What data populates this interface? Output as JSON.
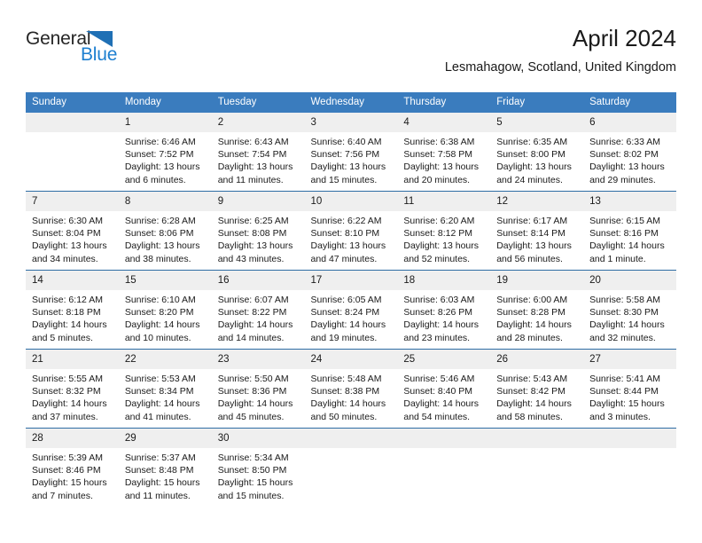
{
  "brand": {
    "name_part1": "General",
    "name_part2": "Blue",
    "triangle_color": "#1f70b5",
    "blue_color": "#1d7fd0"
  },
  "header": {
    "title": "April 2024",
    "subtitle": "Lesmahagow, Scotland, United Kingdom"
  },
  "theme": {
    "header_bg": "#3a7cbe",
    "row_divider": "#2e6da4",
    "daynum_bg": "#efefef"
  },
  "weekdays": [
    "Sunday",
    "Monday",
    "Tuesday",
    "Wednesday",
    "Thursday",
    "Friday",
    "Saturday"
  ],
  "weeks": [
    [
      {
        "day": "",
        "sunrise": "",
        "sunset": "",
        "daylight1": "",
        "daylight2": ""
      },
      {
        "day": "1",
        "sunrise": "Sunrise: 6:46 AM",
        "sunset": "Sunset: 7:52 PM",
        "daylight1": "Daylight: 13 hours",
        "daylight2": "and 6 minutes."
      },
      {
        "day": "2",
        "sunrise": "Sunrise: 6:43 AM",
        "sunset": "Sunset: 7:54 PM",
        "daylight1": "Daylight: 13 hours",
        "daylight2": "and 11 minutes."
      },
      {
        "day": "3",
        "sunrise": "Sunrise: 6:40 AM",
        "sunset": "Sunset: 7:56 PM",
        "daylight1": "Daylight: 13 hours",
        "daylight2": "and 15 minutes."
      },
      {
        "day": "4",
        "sunrise": "Sunrise: 6:38 AM",
        "sunset": "Sunset: 7:58 PM",
        "daylight1": "Daylight: 13 hours",
        "daylight2": "and 20 minutes."
      },
      {
        "day": "5",
        "sunrise": "Sunrise: 6:35 AM",
        "sunset": "Sunset: 8:00 PM",
        "daylight1": "Daylight: 13 hours",
        "daylight2": "and 24 minutes."
      },
      {
        "day": "6",
        "sunrise": "Sunrise: 6:33 AM",
        "sunset": "Sunset: 8:02 PM",
        "daylight1": "Daylight: 13 hours",
        "daylight2": "and 29 minutes."
      }
    ],
    [
      {
        "day": "7",
        "sunrise": "Sunrise: 6:30 AM",
        "sunset": "Sunset: 8:04 PM",
        "daylight1": "Daylight: 13 hours",
        "daylight2": "and 34 minutes."
      },
      {
        "day": "8",
        "sunrise": "Sunrise: 6:28 AM",
        "sunset": "Sunset: 8:06 PM",
        "daylight1": "Daylight: 13 hours",
        "daylight2": "and 38 minutes."
      },
      {
        "day": "9",
        "sunrise": "Sunrise: 6:25 AM",
        "sunset": "Sunset: 8:08 PM",
        "daylight1": "Daylight: 13 hours",
        "daylight2": "and 43 minutes."
      },
      {
        "day": "10",
        "sunrise": "Sunrise: 6:22 AM",
        "sunset": "Sunset: 8:10 PM",
        "daylight1": "Daylight: 13 hours",
        "daylight2": "and 47 minutes."
      },
      {
        "day": "11",
        "sunrise": "Sunrise: 6:20 AM",
        "sunset": "Sunset: 8:12 PM",
        "daylight1": "Daylight: 13 hours",
        "daylight2": "and 52 minutes."
      },
      {
        "day": "12",
        "sunrise": "Sunrise: 6:17 AM",
        "sunset": "Sunset: 8:14 PM",
        "daylight1": "Daylight: 13 hours",
        "daylight2": "and 56 minutes."
      },
      {
        "day": "13",
        "sunrise": "Sunrise: 6:15 AM",
        "sunset": "Sunset: 8:16 PM",
        "daylight1": "Daylight: 14 hours",
        "daylight2": "and 1 minute."
      }
    ],
    [
      {
        "day": "14",
        "sunrise": "Sunrise: 6:12 AM",
        "sunset": "Sunset: 8:18 PM",
        "daylight1": "Daylight: 14 hours",
        "daylight2": "and 5 minutes."
      },
      {
        "day": "15",
        "sunrise": "Sunrise: 6:10 AM",
        "sunset": "Sunset: 8:20 PM",
        "daylight1": "Daylight: 14 hours",
        "daylight2": "and 10 minutes."
      },
      {
        "day": "16",
        "sunrise": "Sunrise: 6:07 AM",
        "sunset": "Sunset: 8:22 PM",
        "daylight1": "Daylight: 14 hours",
        "daylight2": "and 14 minutes."
      },
      {
        "day": "17",
        "sunrise": "Sunrise: 6:05 AM",
        "sunset": "Sunset: 8:24 PM",
        "daylight1": "Daylight: 14 hours",
        "daylight2": "and 19 minutes."
      },
      {
        "day": "18",
        "sunrise": "Sunrise: 6:03 AM",
        "sunset": "Sunset: 8:26 PM",
        "daylight1": "Daylight: 14 hours",
        "daylight2": "and 23 minutes."
      },
      {
        "day": "19",
        "sunrise": "Sunrise: 6:00 AM",
        "sunset": "Sunset: 8:28 PM",
        "daylight1": "Daylight: 14 hours",
        "daylight2": "and 28 minutes."
      },
      {
        "day": "20",
        "sunrise": "Sunrise: 5:58 AM",
        "sunset": "Sunset: 8:30 PM",
        "daylight1": "Daylight: 14 hours",
        "daylight2": "and 32 minutes."
      }
    ],
    [
      {
        "day": "21",
        "sunrise": "Sunrise: 5:55 AM",
        "sunset": "Sunset: 8:32 PM",
        "daylight1": "Daylight: 14 hours",
        "daylight2": "and 37 minutes."
      },
      {
        "day": "22",
        "sunrise": "Sunrise: 5:53 AM",
        "sunset": "Sunset: 8:34 PM",
        "daylight1": "Daylight: 14 hours",
        "daylight2": "and 41 minutes."
      },
      {
        "day": "23",
        "sunrise": "Sunrise: 5:50 AM",
        "sunset": "Sunset: 8:36 PM",
        "daylight1": "Daylight: 14 hours",
        "daylight2": "and 45 minutes."
      },
      {
        "day": "24",
        "sunrise": "Sunrise: 5:48 AM",
        "sunset": "Sunset: 8:38 PM",
        "daylight1": "Daylight: 14 hours",
        "daylight2": "and 50 minutes."
      },
      {
        "day": "25",
        "sunrise": "Sunrise: 5:46 AM",
        "sunset": "Sunset: 8:40 PM",
        "daylight1": "Daylight: 14 hours",
        "daylight2": "and 54 minutes."
      },
      {
        "day": "26",
        "sunrise": "Sunrise: 5:43 AM",
        "sunset": "Sunset: 8:42 PM",
        "daylight1": "Daylight: 14 hours",
        "daylight2": "and 58 minutes."
      },
      {
        "day": "27",
        "sunrise": "Sunrise: 5:41 AM",
        "sunset": "Sunset: 8:44 PM",
        "daylight1": "Daylight: 15 hours",
        "daylight2": "and 3 minutes."
      }
    ],
    [
      {
        "day": "28",
        "sunrise": "Sunrise: 5:39 AM",
        "sunset": "Sunset: 8:46 PM",
        "daylight1": "Daylight: 15 hours",
        "daylight2": "and 7 minutes."
      },
      {
        "day": "29",
        "sunrise": "Sunrise: 5:37 AM",
        "sunset": "Sunset: 8:48 PM",
        "daylight1": "Daylight: 15 hours",
        "daylight2": "and 11 minutes."
      },
      {
        "day": "30",
        "sunrise": "Sunrise: 5:34 AM",
        "sunset": "Sunset: 8:50 PM",
        "daylight1": "Daylight: 15 hours",
        "daylight2": "and 15 minutes."
      },
      {
        "day": "",
        "sunrise": "",
        "sunset": "",
        "daylight1": "",
        "daylight2": ""
      },
      {
        "day": "",
        "sunrise": "",
        "sunset": "",
        "daylight1": "",
        "daylight2": ""
      },
      {
        "day": "",
        "sunrise": "",
        "sunset": "",
        "daylight1": "",
        "daylight2": ""
      },
      {
        "day": "",
        "sunrise": "",
        "sunset": "",
        "daylight1": "",
        "daylight2": ""
      }
    ]
  ]
}
